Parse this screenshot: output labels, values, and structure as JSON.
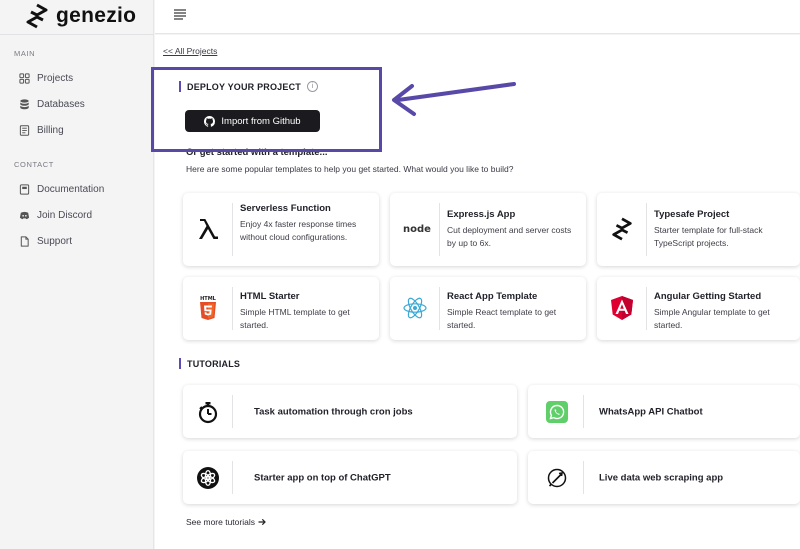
{
  "brand": {
    "name": "genezio"
  },
  "sidebar": {
    "main_label": "MAIN",
    "main_items": [
      {
        "label": "Projects",
        "icon": "grid-icon"
      },
      {
        "label": "Databases",
        "icon": "database-icon"
      },
      {
        "label": "Billing",
        "icon": "billing-icon"
      }
    ],
    "contact_label": "CONTACT",
    "contact_items": [
      {
        "label": "Documentation",
        "icon": "book-icon"
      },
      {
        "label": "Join Discord",
        "icon": "discord-icon"
      },
      {
        "label": "Support",
        "icon": "document-icon"
      }
    ]
  },
  "main": {
    "back_link": "<< All Projects",
    "deploy": {
      "heading": "DEPLOY YOUR PROJECT",
      "import_button": "Import from Github"
    },
    "templates": {
      "heading": "Or get started with a template...",
      "subheading": "Here are some popular templates to help you get started. What would you like to build?",
      "items": [
        {
          "title": "Serverless Function",
          "desc": "Enjoy 4x faster response times without cloud configurations.",
          "icon": "lambda-icon"
        },
        {
          "title": "Express.js App",
          "desc": "Cut deployment and server costs by up to 6x.",
          "icon": "node-icon",
          "icon_text": "node"
        },
        {
          "title": "Typesafe Project",
          "desc": "Starter template for full-stack TypeScript projects.",
          "icon": "genezio-logo-icon"
        },
        {
          "title": "HTML Starter",
          "desc": "Simple HTML template to get started.",
          "icon": "html5-icon",
          "icon_text": "HTML"
        },
        {
          "title": "React App Template",
          "desc": "Simple React template to get started.",
          "icon": "react-icon"
        },
        {
          "title": "Angular Getting Started",
          "desc": "Simple Angular template to get started.",
          "icon": "angular-icon"
        }
      ]
    },
    "tutorials": {
      "heading": "TUTORIALS",
      "items": [
        {
          "title": "Task automation through cron jobs",
          "icon": "stopwatch-icon"
        },
        {
          "title": "WhatsApp API Chatbot",
          "icon": "whatsapp-icon"
        },
        {
          "title": "Starter app on top of ChatGPT",
          "icon": "openai-icon"
        },
        {
          "title": "Live data web scraping app",
          "icon": "scraper-icon"
        }
      ],
      "see_more": "See more tutorials"
    }
  },
  "colors": {
    "accent": "#5b4bb7",
    "highlight": "#5849a8",
    "button_bg": "#1b1b1f"
  }
}
